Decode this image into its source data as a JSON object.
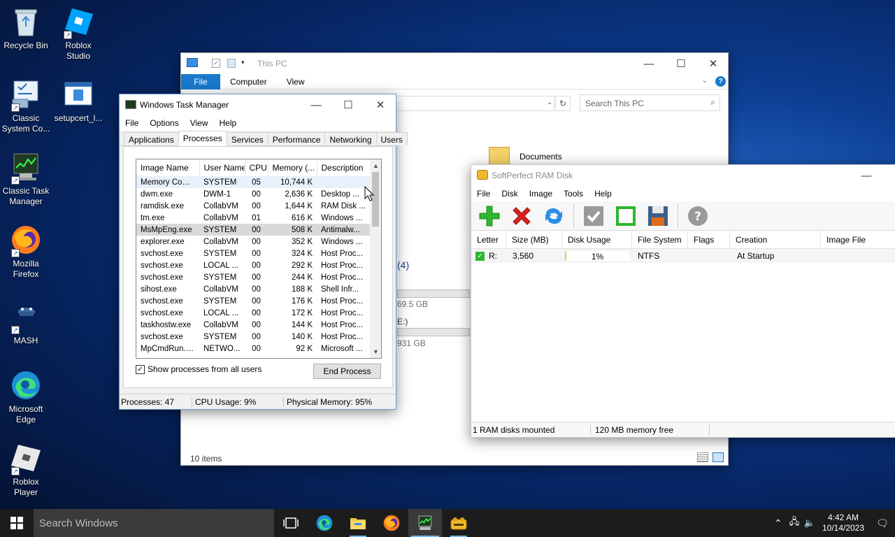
{
  "desktop": {
    "icons": [
      "Recycle Bin",
      "Roblox Studio",
      "Classic System Co...",
      "setupcert_l...",
      "Classic Task Manager",
      "Mozilla Firefox",
      "MASH",
      "Microsoft Edge",
      "Roblox Player"
    ]
  },
  "explorer": {
    "title": "This PC",
    "tabs": [
      "File",
      "Computer",
      "View"
    ],
    "search_placeholder": "Search This PC",
    "documents": "Documents",
    "section_count": "(4)",
    "drive1": "69.5 GB",
    "drive2": "E:)",
    "drive3": "931 GB",
    "status": "10 items"
  },
  "taskmgr": {
    "title": "Windows Task Manager",
    "menu": [
      "File",
      "Options",
      "View",
      "Help"
    ],
    "tabs": [
      "Applications",
      "Processes",
      "Services",
      "Performance",
      "Networking",
      "Users"
    ],
    "columns": [
      "Image Name",
      "User Name",
      "CPU",
      "Memory (...",
      "Description"
    ],
    "rows": [
      [
        "Memory Comp...",
        "SYSTEM",
        "05",
        "10,744 K",
        ""
      ],
      [
        "dwm.exe",
        "DWM-1",
        "00",
        "2,636 K",
        "Desktop ..."
      ],
      [
        "ramdisk.exe",
        "CollabVM",
        "00",
        "1,644 K",
        "RAM Disk ..."
      ],
      [
        "tm.exe",
        "CollabVM",
        "01",
        "616 K",
        "Windows ..."
      ],
      [
        "MsMpEng.exe",
        "SYSTEM",
        "00",
        "508 K",
        "Antimalw..."
      ],
      [
        "explorer.exe",
        "CollabVM",
        "00",
        "352 K",
        "Windows ..."
      ],
      [
        "svchost.exe",
        "SYSTEM",
        "00",
        "324 K",
        "Host Proc..."
      ],
      [
        "svchost.exe",
        "LOCAL ...",
        "00",
        "292 K",
        "Host Proc..."
      ],
      [
        "svchost.exe",
        "SYSTEM",
        "00",
        "244 K",
        "Host Proc..."
      ],
      [
        "sihost.exe",
        "CollabVM",
        "00",
        "188 K",
        "Shell Infr..."
      ],
      [
        "svchost.exe",
        "SYSTEM",
        "00",
        "176 K",
        "Host Proc..."
      ],
      [
        "svchost.exe",
        "LOCAL ...",
        "00",
        "172 K",
        "Host Proc..."
      ],
      [
        "taskhostw.exe",
        "CollabVM",
        "00",
        "144 K",
        "Host Proc..."
      ],
      [
        "svchost.exe",
        "SYSTEM",
        "00",
        "140 K",
        "Host Proc..."
      ],
      [
        "MpCmdRun.exe",
        "NETWO...",
        "00",
        "92 K",
        "Microsoft ..."
      ]
    ],
    "show_all": "Show processes from all users",
    "end_process": "End Process",
    "status": [
      "Processes: 47",
      "CPU Usage: 9%",
      "Physical Memory: 95%"
    ]
  },
  "ramdisk": {
    "title": "SoftPerfect RAM Disk",
    "menu": [
      "File",
      "Disk",
      "Image",
      "Tools",
      "Help"
    ],
    "columns": [
      "Letter",
      "Size (MB)",
      "Disk Usage",
      "File System",
      "Flags",
      "Creation",
      "Image File"
    ],
    "row": {
      "letter": "R:",
      "size": "3,560",
      "usage": "1%",
      "usage_fraction": 0.01,
      "fs": "NTFS",
      "flags": "",
      "creation": "At Startup",
      "image": ""
    },
    "status": [
      "1 RAM disks mounted",
      "120 MB memory free"
    ]
  },
  "taskbar": {
    "search": "Search Windows",
    "time": "4:42 AM",
    "date": "10/14/2023"
  },
  "colors": {
    "accent": "#0078d7",
    "taskbar": "#1c1c1c",
    "green": "#2fb62f",
    "red": "#d92020"
  }
}
